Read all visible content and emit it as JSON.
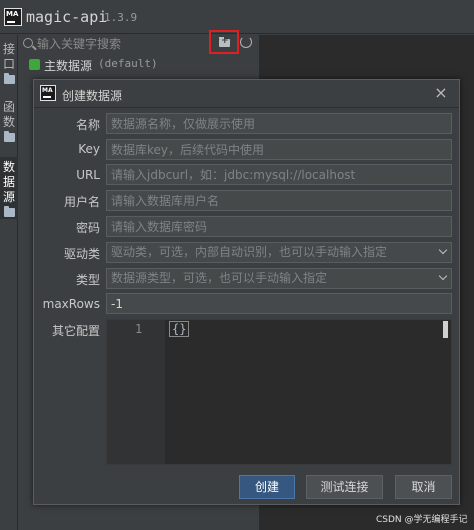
{
  "app": {
    "title": "magic-api",
    "version": "1.3.9",
    "logo_text": "MA"
  },
  "left_tabs": [
    {
      "label": "接\n口"
    },
    {
      "label": "函\n数"
    },
    {
      "label": "数\n据\n源"
    }
  ],
  "panel": {
    "search_placeholder": "输入关键字搜索",
    "datasource_name": "主数据源",
    "datasource_key": "(default)"
  },
  "dialog": {
    "title": "创建数据源",
    "close_icon": "×",
    "fields": {
      "name": {
        "label": "名称",
        "placeholder": "数据源名称，仅做展示使用"
      },
      "key": {
        "label": "Key",
        "placeholder": "数据库key，后续代码中使用"
      },
      "url": {
        "label": "URL",
        "placeholder": "请输入jdbcurl，如：jdbc:mysql://localhost"
      },
      "username": {
        "label": "用户名",
        "placeholder": "请输入数据库用户名"
      },
      "password": {
        "label": "密码",
        "placeholder": "请输入数据库密码"
      },
      "driver": {
        "label": "驱动类",
        "placeholder": "驱动类，可选，内部自动识别，也可以手动输入指定"
      },
      "type": {
        "label": "类型",
        "placeholder": "数据源类型，可选，也可以手动输入指定"
      },
      "maxrows": {
        "label": "maxRows",
        "value": "-1"
      },
      "other": {
        "label": "其它配置",
        "line_number": "1",
        "code": "{}"
      }
    },
    "buttons": {
      "create": "创建",
      "test": "测试连接",
      "cancel": "取消"
    }
  },
  "watermark": "CSDN @学无编程手记"
}
